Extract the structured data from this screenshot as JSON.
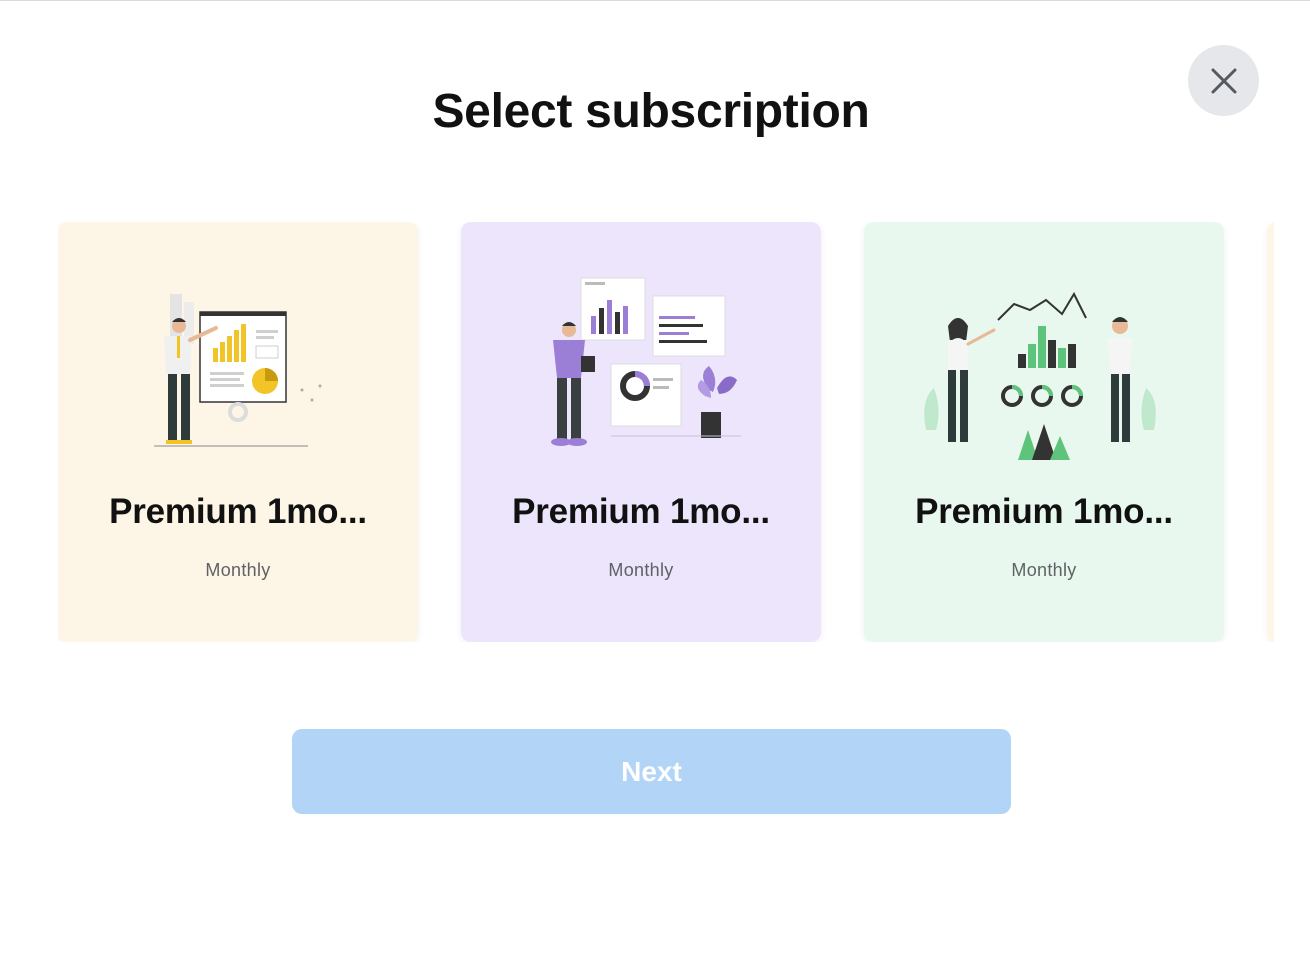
{
  "dialog": {
    "title": "Select subscription",
    "close_icon": "close-icon"
  },
  "plans": [
    {
      "name": "Premium 1mo...",
      "period": "Monthly",
      "illustration": "presentation-illustration",
      "background": "#fdf6e7",
      "accent": "#f2c428"
    },
    {
      "name": "Premium 1mo...",
      "period": "Monthly",
      "illustration": "dashboard-illustration",
      "background": "#ede5fb",
      "accent": "#9b7fd6"
    },
    {
      "name": "Premium 1mo...",
      "period": "Monthly",
      "illustration": "analytics-illustration",
      "background": "#e9f8ee",
      "accent": "#5ec47c"
    }
  ],
  "actions": {
    "next_label": "Next",
    "next_color": "#b1d4f7"
  }
}
